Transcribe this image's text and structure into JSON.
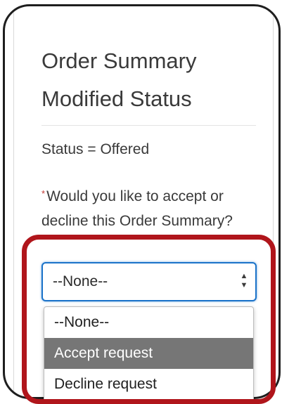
{
  "form": {
    "title_line1": "Order Summary",
    "title_line2": "Modified Status",
    "status_text": "Status = Offered",
    "required_marker": "*",
    "question": "Would you like to accept or decline this Order Summary?"
  },
  "select": {
    "current_value": "--None--",
    "options": [
      {
        "label": "--None--",
        "highlighted": false
      },
      {
        "label": "Accept request",
        "highlighted": true
      },
      {
        "label": "Decline request",
        "highlighted": false
      }
    ]
  },
  "colors": {
    "focus_border": "#1b73c9",
    "highlight_option": "#767676",
    "annotation_red": "#b0151b",
    "required_star": "#c23934"
  }
}
